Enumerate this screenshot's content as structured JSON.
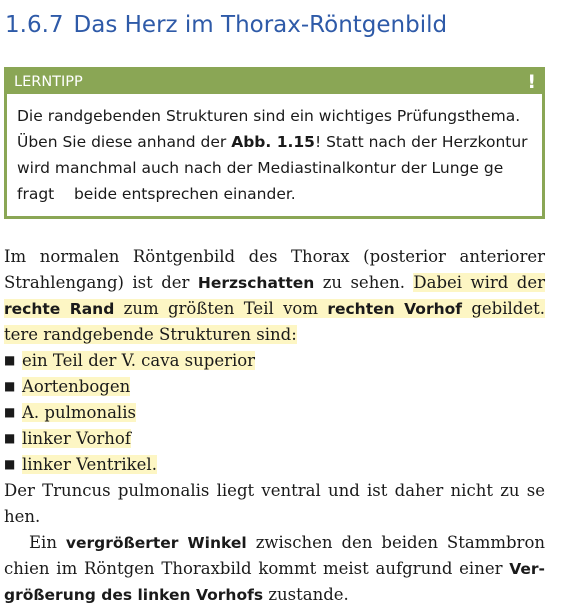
{
  "heading": {
    "number": "1.6.7",
    "title": "Das Herz im Thorax-Röntgenbild"
  },
  "tip": {
    "label": "LERNTIPP",
    "mark": "!",
    "lines": [
      [
        "Die randgebenden Strukturen sind ein wichtiges Prüfungsthema."
      ],
      [
        "Üben Sie diese anhand der ",
        "Abb. 1.15",
        "! Statt nach der Herzkontur"
      ],
      [
        "wird manchmal auch nach der Mediastinalkontur der Lunge ge"
      ],
      [
        "fragt    beide entsprechen einander."
      ]
    ]
  },
  "p1": {
    "l1": "Im normalen Röntgenbild des Thorax (posterior anteriorer",
    "l2a": "Strahlengang) ist der ",
    "l2b": "Herzschatten",
    "l2c": " zu sehen. ",
    "l2d": "Dabei wird der",
    "l3a": "rechte Rand",
    "l3b": " zum größten Teil vom ",
    "l3c": "rechten Vorhof",
    "l3d": " gebildet. Wei",
    "l4": "tere randgebende Strukturen sind:"
  },
  "list": [
    "ein Teil der V. cava superior",
    "Aortenbogen",
    "A. pulmonalis",
    "linker Vorhof",
    "linker Ventrikel."
  ],
  "p2": {
    "l1": "Der Truncus pulmonalis liegt ventral und ist daher nicht zu se",
    "l2": "hen."
  },
  "p3": {
    "l1a": "Ein ",
    "l1b": "vergrößerter Winkel",
    "l1c": " zwischen den beiden Stammbron",
    "l2a": "chien im Röntgen Thoraxbild kommt meist aufgrund einer ",
    "l2b": "Ver-",
    "l3a": "größerung des linken Vorhofs",
    "l3b": " zustande."
  },
  "colors": {
    "heading": "#2e5aa8",
    "tip_green": "#8aa655",
    "highlight": "#fdf6c4"
  }
}
